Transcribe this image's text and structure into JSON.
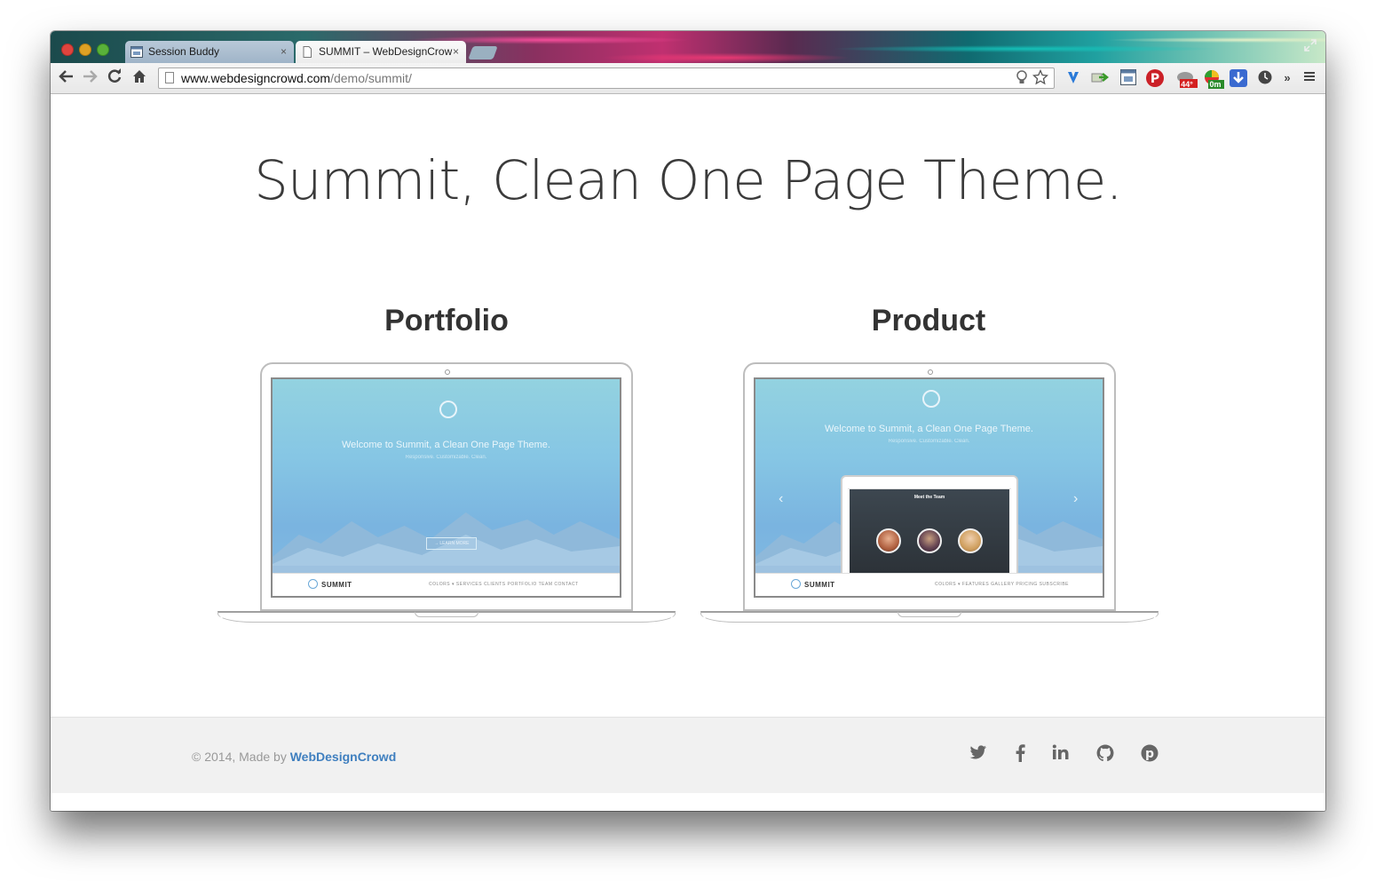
{
  "browser": {
    "tabs": [
      {
        "label": "Session Buddy"
      },
      {
        "label": "SUMMIT – WebDesignCrow"
      }
    ],
    "close_glyph": "×",
    "url_host": "www.webdesigncrowd.com",
    "url_path": "/demo/summit/",
    "extension_badges": {
      "weather": "44°",
      "timer": "0m"
    }
  },
  "page": {
    "hero_title": "Summit, Clean One Page Theme.",
    "demos": [
      {
        "title": "Portfolio",
        "screen": {
          "headline": "Welcome to Summit, a Clean One Page Theme.",
          "subline": "Responsive. Customizable. Clean.",
          "button": "→ LEARN MORE",
          "brand": "SUMMIT",
          "nav": "COLORS ▾      SERVICES      CLIENTS      PORTFOLIO      TEAM      CONTACT"
        }
      },
      {
        "title": "Product",
        "screen": {
          "headline": "Welcome to Summit, a Clean One Page Theme.",
          "subline": "Responsive. Customizable. Clean.",
          "inner_title": "Meet the Team",
          "brand": "SUMMIT",
          "nav": "COLORS ▾      FEATURES      GALLERY      PRICING      SUBSCRIBE"
        }
      }
    ],
    "footer": {
      "copyright_prefix": "© 2014, Made by ",
      "copyright_brand": "WebDesignCrowd"
    }
  },
  "colors": {
    "accent": "#3f7fbf",
    "heading": "#333333",
    "footer_bg": "#f1f1f1"
  }
}
